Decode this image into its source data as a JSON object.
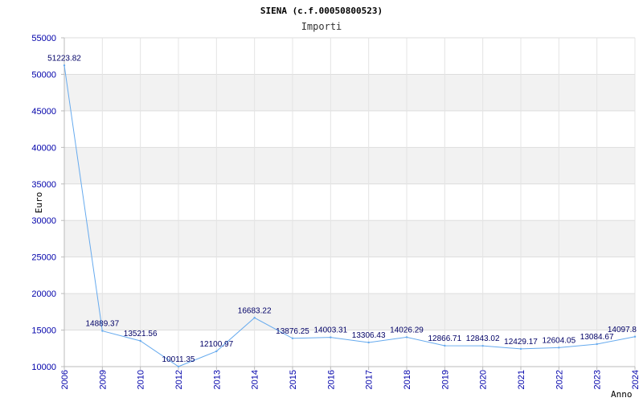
{
  "chart_data": {
    "type": "line",
    "title": "SIENA (c.f.00050800523)",
    "subtitle": "Importi",
    "xlabel": "Anno",
    "ylabel": "Euro",
    "ylim": [
      10000,
      55000
    ],
    "yticks": [
      "10000",
      "15000",
      "20000",
      "25000",
      "30000",
      "35000",
      "40000",
      "45000",
      "50000",
      "55000"
    ],
    "grid": true,
    "categories": [
      "2006",
      "2009",
      "2010",
      "2012",
      "2013",
      "2014",
      "2015",
      "2016",
      "2017",
      "2018",
      "2019",
      "2020",
      "2021",
      "2022",
      "2023",
      "2024"
    ],
    "values": [
      51223.82,
      14889.37,
      13521.56,
      10011.35,
      12100.97,
      16683.22,
      13876.25,
      14003.31,
      13306.43,
      14026.29,
      12866.71,
      12843.02,
      12429.17,
      12604.05,
      13084.67,
      14097.8
    ],
    "labels": [
      "51223.82",
      "14889.37",
      "13521.56",
      "10011.35",
      "12100.97",
      "16683.22",
      "13876.25",
      "14003.31",
      "13306.43",
      "14026.29",
      "12866.71",
      "12843.02",
      "12429.17",
      "12604.05",
      "13084.67",
      "14097.8"
    ],
    "line_color": "#66aaee",
    "band_color": "#f2f2f2",
    "tick_color": "#0000aa"
  }
}
